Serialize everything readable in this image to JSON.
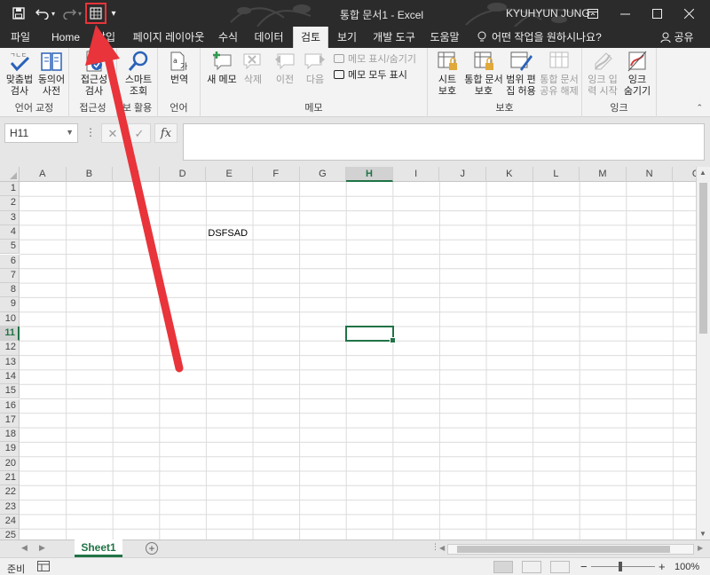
{
  "titlebar": {
    "title": "통합 문서1  -  Excel",
    "user": "KYUHYUN JUNG",
    "qa_more": "▾"
  },
  "tabs": [
    "파일",
    "Home",
    "삽입",
    "페이지 레이아웃",
    "수식",
    "데이터",
    "검토",
    "보기",
    "개발 도구",
    "도움말"
  ],
  "active_tab": "검토",
  "tell_me": "어떤 작업을 원하시나요?",
  "share": "공유",
  "ribbon": {
    "groups": [
      {
        "label": "언어 교정",
        "buttons": [
          "맞춤법\n검사",
          "동의어\n사전"
        ]
      },
      {
        "label": "접근성",
        "buttons": [
          "접근성\n검사"
        ]
      },
      {
        "label": "정보 활용",
        "buttons": [
          "스마트\n조회"
        ]
      },
      {
        "label": "언어",
        "buttons": [
          "번역"
        ]
      },
      {
        "label": "메모",
        "buttons": [
          "새 메모",
          "삭제",
          "이전",
          "다음"
        ],
        "small": [
          "메모 표시/숨기기",
          "메모 모두 표시"
        ]
      },
      {
        "label": "보호",
        "buttons": [
          "시트\n보호",
          "통합 문서\n보호",
          "범위 편\n집 허용",
          "통합 문서\n공유 해제"
        ]
      },
      {
        "label": "잉크",
        "buttons": [
          "잉크 입\n력 시작",
          "잉크\n숨기기"
        ]
      }
    ]
  },
  "formula_bar": {
    "name_box": "H11",
    "fx": "fx",
    "cancel": "✕",
    "enter": "✓",
    "formula": ""
  },
  "grid": {
    "columns": [
      "A",
      "B",
      "C",
      "D",
      "E",
      "F",
      "G",
      "H",
      "I",
      "J",
      "K",
      "L",
      "M",
      "N",
      "O"
    ],
    "rows": [
      1,
      2,
      3,
      4,
      5,
      6,
      7,
      8,
      9,
      10,
      11,
      12,
      13,
      14,
      15,
      16,
      17,
      18,
      19,
      20,
      21,
      22,
      23,
      24,
      25
    ],
    "selected_column": "H",
    "selected_row": 11,
    "cells": [
      {
        "ref": "E4",
        "value": "DSFSAD"
      }
    ]
  },
  "sheets": [
    "Sheet1"
  ],
  "active_sheet": "Sheet1",
  "status": {
    "ready": "준비",
    "zoom": "100%"
  },
  "colors": {
    "excel_green": "#217346",
    "titlebar": "#2b2b2b",
    "annotation_red": "#e8343a"
  }
}
